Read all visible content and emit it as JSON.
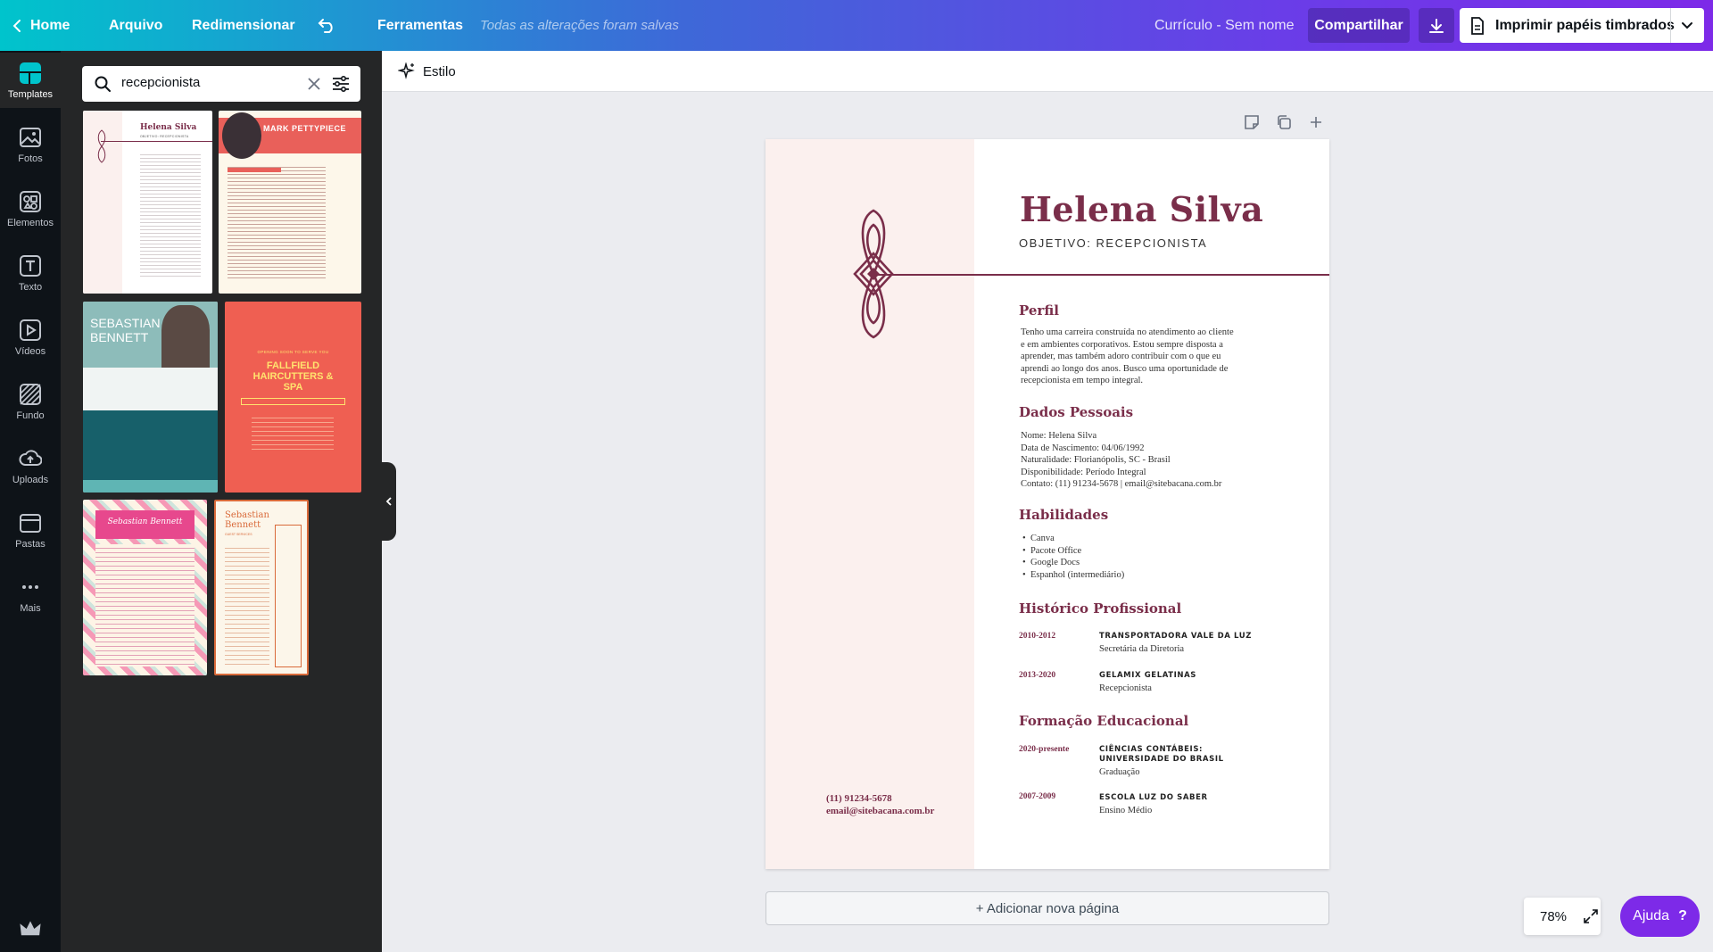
{
  "topbar": {
    "home": "Home",
    "file": "Arquivo",
    "resize": "Redimensionar",
    "tools": "Ferramentas",
    "saved_status": "Todas as alterações foram salvas",
    "doc_title": "Currículo - Sem nome",
    "share": "Compartilhar",
    "print": "Imprimir papéis timbrados"
  },
  "rail": {
    "templates": "Templates",
    "photos": "Fotos",
    "elements": "Elementos",
    "text": "Texto",
    "videos": "Vídeos",
    "background": "Fundo",
    "uploads": "Uploads",
    "folders": "Pastas",
    "more": "Mais"
  },
  "panel": {
    "search_value": "recepcionista",
    "templates": [
      {
        "name": "Helena Silva",
        "subtitle": "OBJETIVO: RECEPCIONISTA"
      },
      {
        "name": "MARK PETTYPIECE",
        "subtitle": ""
      },
      {
        "name": "SEBASTIAN BENNETT",
        "subtitle": ""
      },
      {
        "name": "FALLFIELD HAIRCUTTERS & SPA",
        "subtitle": "OPENING SOON TO SERVE YOU"
      },
      {
        "name": "Sebastian Bennett",
        "subtitle": ""
      },
      {
        "name": "Sebastian Bennett",
        "subtitle": "GUEST SERVICES"
      }
    ]
  },
  "stylebar": {
    "style": "Estilo"
  },
  "resume": {
    "name": "Helena Silva",
    "objective": "OBJETIVO: RECEPCIONISTA",
    "profile_h": "Perfil",
    "profile_lines": [
      "Tenho uma carreira construída no atendimento ao cliente",
      "e em ambientes corporativos. Estou sempre disposta a",
      "aprender, mas também adoro contribuir com o que eu",
      "aprendi ao longo dos anos. Busco uma oportunidade de",
      "recepcionista em tempo integral."
    ],
    "personal_h": "Dados Pessoais",
    "personal_lines": [
      "Nome: Helena Silva",
      "Data de Nascimento: 04/06/1992",
      "Naturalidade: Florianópolis, SC - Brasil",
      "Disponibilidade: Período Integral",
      "Contato: (11) 91234-5678 | email@sitebacana.com.br"
    ],
    "skills_h": "Habilidades",
    "skills": [
      "Canva",
      "Pacote Office",
      "Google Docs",
      "Espanhol (intermediário)"
    ],
    "history_h": "Histórico Profissional",
    "jobs": [
      {
        "years": "2010-2012",
        "company": "TRANSPORTADORA VALE DA LUZ",
        "role": "Secretária da Diretoria"
      },
      {
        "years": "2013-2020",
        "company": "GELAMIX GELATINAS",
        "role": "Recepcionista"
      }
    ],
    "education_h": "Formação Educacional",
    "education": [
      {
        "years": "2020-presente",
        "company1": "CIÊNCIAS CONTÁBEIS:",
        "company2": "UNIVERSIDADE DO BRASIL",
        "role": "Graduação"
      },
      {
        "years": "2007-2009",
        "company1": "ESCOLA LUZ DO SABER",
        "company2": "",
        "role": "Ensino Médio"
      }
    ],
    "phone": "(11) 91234-5678",
    "email": "email@sitebacana.com.br"
  },
  "canvas": {
    "add_page": "+ Adicionar nova página",
    "zoom": "78%",
    "help": "Ajuda",
    "help_icon": "?"
  },
  "colors": {
    "accent": "#7a2e4a",
    "brand_purple": "#7d2ae8",
    "brand_teal": "#00c4cc"
  }
}
